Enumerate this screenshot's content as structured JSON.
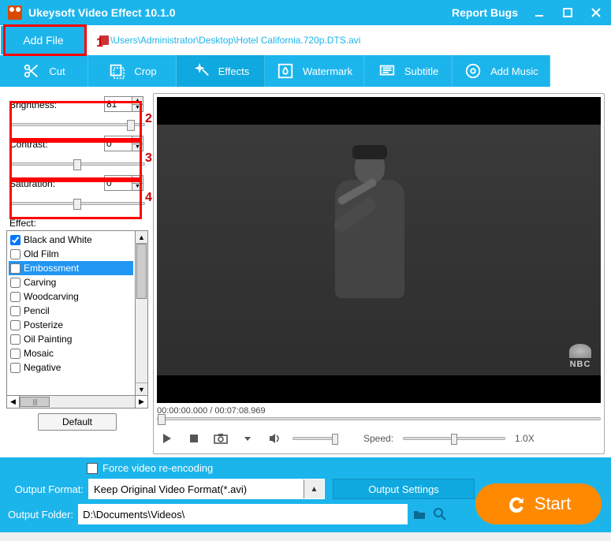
{
  "titlebar": {
    "app_title": "Ukeysoft Video Effect 10.1.0",
    "report_bugs": "Report Bugs"
  },
  "addfile": {
    "button": "Add File",
    "filepath": "\\Users\\Administrator\\Desktop\\Hotel California.720p.DTS.avi"
  },
  "tabs": {
    "cut": "Cut",
    "crop": "Crop",
    "effects": "Effects",
    "watermark": "Watermark",
    "subtitle": "Subtitle",
    "add_music": "Add Music",
    "active": "effects"
  },
  "params": {
    "brightness": {
      "label": "Brightness:",
      "value": "81",
      "slider_pct": 90
    },
    "contrast": {
      "label": "Contrast:",
      "value": "0",
      "slider_pct": 50
    },
    "saturation": {
      "label": "Saturation:",
      "value": "0",
      "slider_pct": 50
    }
  },
  "effects": {
    "label": "Effect:",
    "items": [
      {
        "name": "Black and White",
        "checked": true,
        "selected": false
      },
      {
        "name": "Old Film",
        "checked": false,
        "selected": false
      },
      {
        "name": "Embossment",
        "checked": false,
        "selected": true
      },
      {
        "name": "Carving",
        "checked": false,
        "selected": false
      },
      {
        "name": "Woodcarving",
        "checked": false,
        "selected": false
      },
      {
        "name": "Pencil",
        "checked": false,
        "selected": false
      },
      {
        "name": "Posterize",
        "checked": false,
        "selected": false
      },
      {
        "name": "Oil Painting",
        "checked": false,
        "selected": false
      },
      {
        "name": "Mosaic",
        "checked": false,
        "selected": false
      },
      {
        "name": "Negative",
        "checked": false,
        "selected": false
      }
    ],
    "default_btn": "Default"
  },
  "preview": {
    "timecode": "00:00:00.000 / 00:07:08.969",
    "watermark": "NBC",
    "speed_label": "Speed:",
    "speed_value": "1.0X"
  },
  "bottom": {
    "force_label": "Force video re-encoding",
    "output_format_label": "Output Format:",
    "output_format_value": "Keep Original Video Format(*.avi)",
    "output_settings": "Output Settings",
    "output_folder_label": "Output Folder:",
    "output_folder_value": "D:\\Documents\\Videos\\",
    "start": "Start"
  },
  "annotations": {
    "a1": "1",
    "a2": "2",
    "a3": "3",
    "a4": "4"
  }
}
